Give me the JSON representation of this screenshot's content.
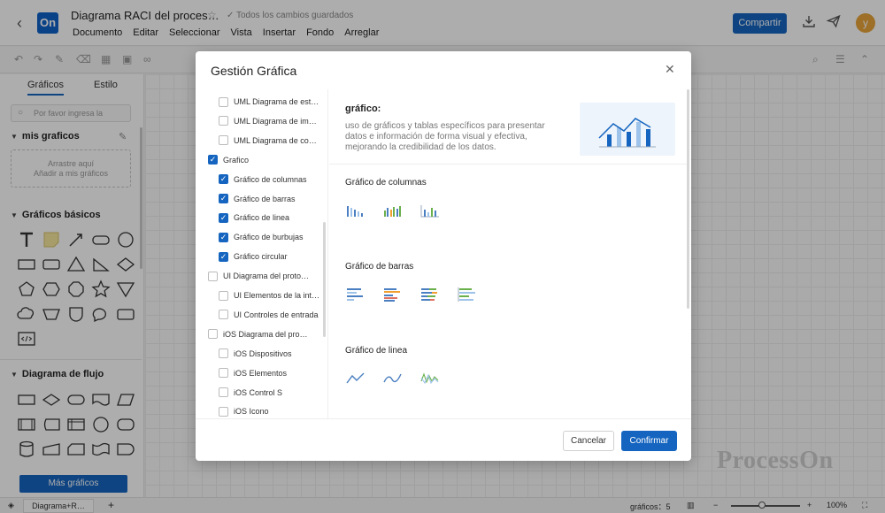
{
  "header": {
    "logo_text": "On",
    "doc_title": "Diagrama RACI del proces…",
    "saved_status": "Todos los cambios guardados",
    "menu": [
      "Documento",
      "Editar",
      "Seleccionar",
      "Vista",
      "Insertar",
      "Fondo",
      "Arreglar"
    ],
    "share_label": "Compartir",
    "avatar_initial": "y"
  },
  "sidebar": {
    "tabs": [
      "Gráficos",
      "Estilo"
    ],
    "search_placeholder": "Por favor ingresa la",
    "my_graphics_label": "mis graficos",
    "drop_zone_line1": "Arrastre aquí",
    "drop_zone_line2": "Añadir a mis gráficos",
    "basic_label": "Gráficos básicos",
    "flow_label": "Diagrama de flujo",
    "more_button": "Más gráficos"
  },
  "statusbar": {
    "page_tab": "Diagrama+R…",
    "shapes_count": "gráficos：5",
    "zoom": "100%"
  },
  "watermark": "ProcessOn",
  "modal": {
    "title": "Gestión Gráfica",
    "tree": [
      {
        "label": "UML Diagrama de est…",
        "checked": false,
        "indent": 1
      },
      {
        "label": "UML Diagrama de im…",
        "checked": false,
        "indent": 1
      },
      {
        "label": "UML Diagrama de co…",
        "checked": false,
        "indent": 1
      },
      {
        "label": "Grafico",
        "checked": true,
        "indent": 0
      },
      {
        "label": "Gráfico de columnas",
        "checked": true,
        "indent": 1
      },
      {
        "label": "Gráfico de barras",
        "checked": true,
        "indent": 1
      },
      {
        "label": "Gráfico de linea",
        "checked": true,
        "indent": 1
      },
      {
        "label": "Gráfico de burbujas",
        "checked": true,
        "indent": 1
      },
      {
        "label": "Gráfico circular",
        "checked": true,
        "indent": 1
      },
      {
        "label": "UI Diagrama del proto…",
        "checked": false,
        "indent": 0
      },
      {
        "label": "UI Elementos de la int…",
        "checked": false,
        "indent": 1
      },
      {
        "label": "UI Controles de entrada",
        "checked": false,
        "indent": 1
      },
      {
        "label": "iOS Diagrama del pro…",
        "checked": false,
        "indent": 0
      },
      {
        "label": "iOS Dispositivos",
        "checked": false,
        "indent": 1
      },
      {
        "label": "iOS Elementos",
        "checked": false,
        "indent": 1
      },
      {
        "label": "iOS Control S",
        "checked": false,
        "indent": 1
      },
      {
        "label": "iOS Icono",
        "checked": false,
        "indent": 1
      }
    ],
    "info_title": "gráfico:",
    "info_desc": "uso de gráficos y tablas específicos para presentar datos e información de forma visual y efectiva, mejorando la credibilidad de los datos.",
    "categories": [
      "Gráfico de columnas",
      "Gráfico de barras",
      "Gráfico de linea"
    ],
    "cancel_label": "Cancelar",
    "confirm_label": "Confirmar",
    "accent_color": "#1565c0"
  }
}
